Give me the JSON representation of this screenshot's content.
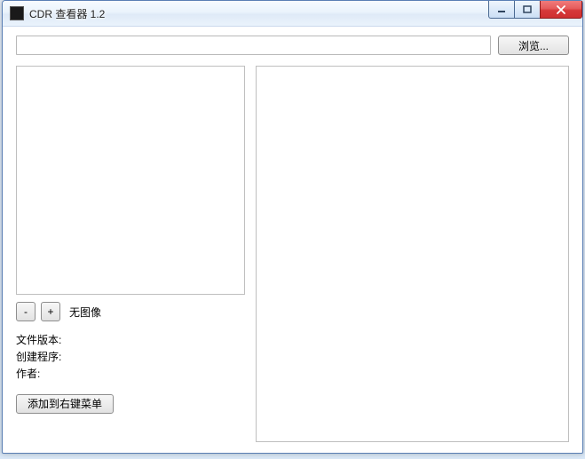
{
  "window": {
    "title": "CDR 查看器 1.2"
  },
  "path": {
    "value": "",
    "browse_label": "浏览..."
  },
  "zoom": {
    "minus_label": "-",
    "plus_label": "+",
    "no_image_label": "无图像"
  },
  "info": {
    "file_version_label": "文件版本:",
    "creator_label": "创建程序:",
    "author_label": "作者:",
    "file_version_value": "",
    "creator_value": "",
    "author_value": ""
  },
  "context_menu_button": "添加到右键菜单"
}
